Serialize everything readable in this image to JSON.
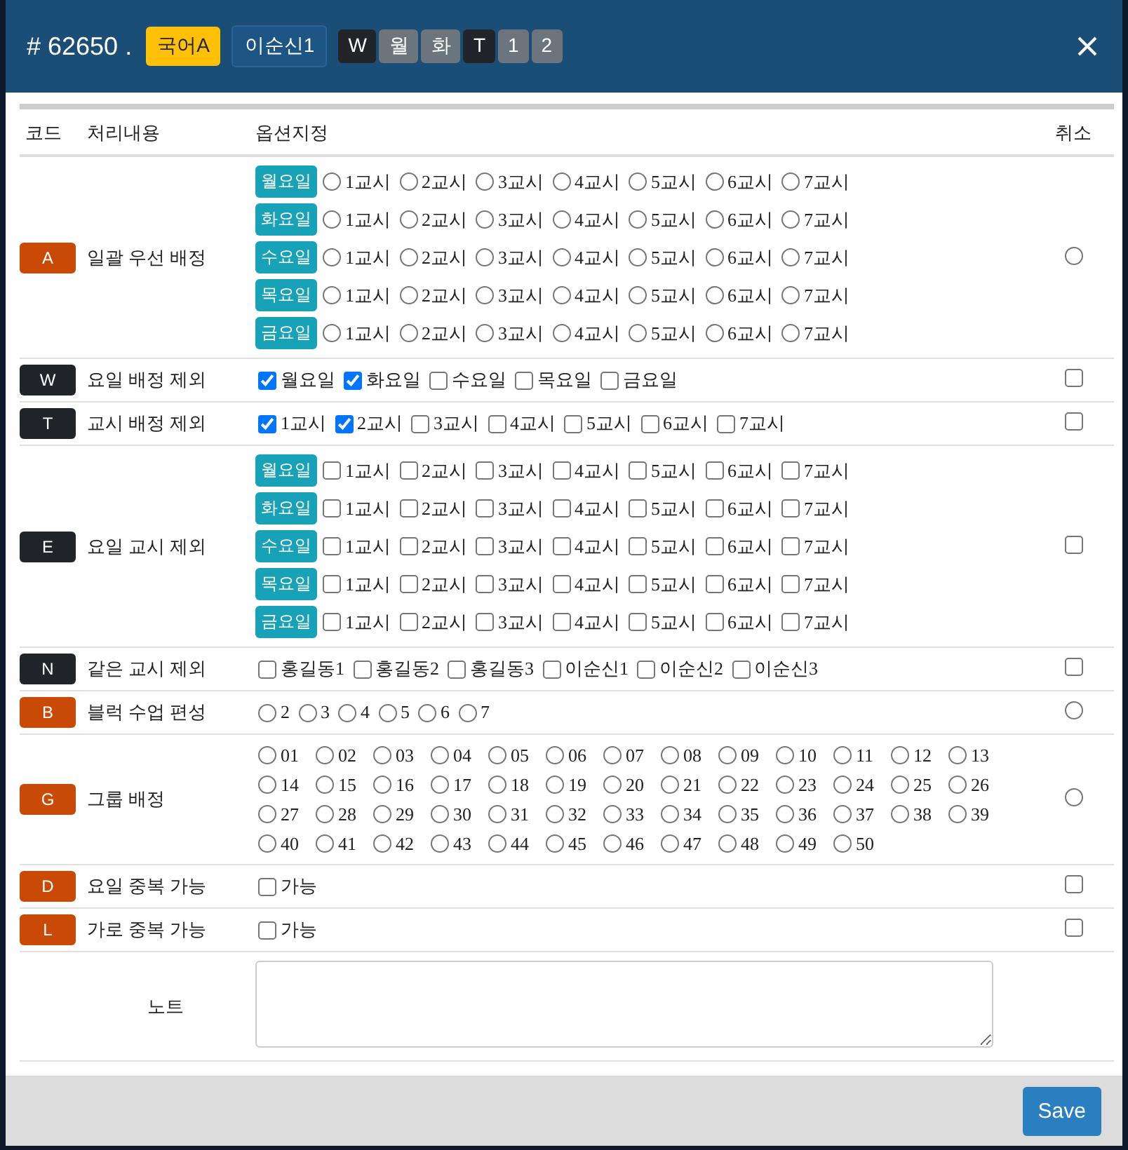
{
  "header": {
    "title": "# 62650 .",
    "subject": "국어A",
    "teacher": "이순신1",
    "tags": [
      {
        "label": "W",
        "color": "#212529"
      },
      {
        "label": "월",
        "color": "#6c757d"
      },
      {
        "label": "화",
        "color": "#6c757d"
      },
      {
        "label": "T",
        "color": "#212529"
      },
      {
        "label": "1",
        "color": "#6c757d"
      },
      {
        "label": "2",
        "color": "#6c757d"
      }
    ]
  },
  "columns": [
    "코드",
    "처리내용",
    "옵션지정",
    "취소"
  ],
  "rows": [
    {
      "code": "A",
      "color": "#c94a06",
      "label": "일괄 우선 배정",
      "kind": "radio_grid",
      "cancel": {
        "kind": "radio",
        "checked": false
      },
      "days": [
        {
          "label": "월요일",
          "periods": [
            {
              "label": "1교시",
              "checked": false
            },
            {
              "label": "2교시",
              "checked": false
            },
            {
              "label": "3교시",
              "checked": false
            },
            {
              "label": "4교시",
              "checked": false
            },
            {
              "label": "5교시",
              "checked": false
            },
            {
              "label": "6교시",
              "checked": false
            },
            {
              "label": "7교시",
              "checked": false
            }
          ]
        },
        {
          "label": "화요일",
          "periods": [
            {
              "label": "1교시",
              "checked": false
            },
            {
              "label": "2교시",
              "checked": false
            },
            {
              "label": "3교시",
              "checked": false
            },
            {
              "label": "4교시",
              "checked": false
            },
            {
              "label": "5교시",
              "checked": false
            },
            {
              "label": "6교시",
              "checked": false
            },
            {
              "label": "7교시",
              "checked": false
            }
          ]
        },
        {
          "label": "수요일",
          "periods": [
            {
              "label": "1교시",
              "checked": false
            },
            {
              "label": "2교시",
              "checked": false
            },
            {
              "label": "3교시",
              "checked": false
            },
            {
              "label": "4교시",
              "checked": false
            },
            {
              "label": "5교시",
              "checked": false
            },
            {
              "label": "6교시",
              "checked": false
            },
            {
              "label": "7교시",
              "checked": false
            }
          ]
        },
        {
          "label": "목요일",
          "periods": [
            {
              "label": "1교시",
              "checked": false
            },
            {
              "label": "2교시",
              "checked": false
            },
            {
              "label": "3교시",
              "checked": false
            },
            {
              "label": "4교시",
              "checked": false
            },
            {
              "label": "5교시",
              "checked": false
            },
            {
              "label": "6교시",
              "checked": false
            },
            {
              "label": "7교시",
              "checked": false
            }
          ]
        },
        {
          "label": "금요일",
          "periods": [
            {
              "label": "1교시",
              "checked": false
            },
            {
              "label": "2교시",
              "checked": false
            },
            {
              "label": "3교시",
              "checked": false
            },
            {
              "label": "4교시",
              "checked": false
            },
            {
              "label": "5교시",
              "checked": false
            },
            {
              "label": "6교시",
              "checked": false
            },
            {
              "label": "7교시",
              "checked": false
            }
          ]
        }
      ]
    },
    {
      "code": "W",
      "color": "#212529",
      "label": "요일 배정 제외",
      "kind": "checkbox_list",
      "cancel": {
        "kind": "checkbox",
        "checked": false
      },
      "options": [
        {
          "label": "월요일",
          "checked": true
        },
        {
          "label": "화요일",
          "checked": true
        },
        {
          "label": "수요일",
          "checked": false
        },
        {
          "label": "목요일",
          "checked": false
        },
        {
          "label": "금요일",
          "checked": false
        }
      ]
    },
    {
      "code": "T",
      "color": "#212529",
      "label": "교시 배정 제외",
      "kind": "checkbox_list",
      "cancel": {
        "kind": "checkbox",
        "checked": false
      },
      "options": [
        {
          "label": "1교시",
          "checked": true
        },
        {
          "label": "2교시",
          "checked": true
        },
        {
          "label": "3교시",
          "checked": false
        },
        {
          "label": "4교시",
          "checked": false
        },
        {
          "label": "5교시",
          "checked": false
        },
        {
          "label": "6교시",
          "checked": false
        },
        {
          "label": "7교시",
          "checked": false
        }
      ]
    },
    {
      "code": "E",
      "color": "#212529",
      "label": "요일 교시 제외",
      "kind": "checkbox_grid",
      "cancel": {
        "kind": "checkbox",
        "checked": false
      },
      "days": [
        {
          "label": "월요일",
          "periods": [
            {
              "label": "1교시",
              "checked": false
            },
            {
              "label": "2교시",
              "checked": false
            },
            {
              "label": "3교시",
              "checked": false
            },
            {
              "label": "4교시",
              "checked": false
            },
            {
              "label": "5교시",
              "checked": false
            },
            {
              "label": "6교시",
              "checked": false
            },
            {
              "label": "7교시",
              "checked": false
            }
          ]
        },
        {
          "label": "화요일",
          "periods": [
            {
              "label": "1교시",
              "checked": false
            },
            {
              "label": "2교시",
              "checked": false
            },
            {
              "label": "3교시",
              "checked": false
            },
            {
              "label": "4교시",
              "checked": false
            },
            {
              "label": "5교시",
              "checked": false
            },
            {
              "label": "6교시",
              "checked": false
            },
            {
              "label": "7교시",
              "checked": false
            }
          ]
        },
        {
          "label": "수요일",
          "periods": [
            {
              "label": "1교시",
              "checked": false
            },
            {
              "label": "2교시",
              "checked": false
            },
            {
              "label": "3교시",
              "checked": false
            },
            {
              "label": "4교시",
              "checked": false
            },
            {
              "label": "5교시",
              "checked": false
            },
            {
              "label": "6교시",
              "checked": false
            },
            {
              "label": "7교시",
              "checked": false
            }
          ]
        },
        {
          "label": "목요일",
          "periods": [
            {
              "label": "1교시",
              "checked": false
            },
            {
              "label": "2교시",
              "checked": false
            },
            {
              "label": "3교시",
              "checked": false
            },
            {
              "label": "4교시",
              "checked": false
            },
            {
              "label": "5교시",
              "checked": false
            },
            {
              "label": "6교시",
              "checked": false
            },
            {
              "label": "7교시",
              "checked": false
            }
          ]
        },
        {
          "label": "금요일",
          "periods": [
            {
              "label": "1교시",
              "checked": false
            },
            {
              "label": "2교시",
              "checked": false
            },
            {
              "label": "3교시",
              "checked": false
            },
            {
              "label": "4교시",
              "checked": false
            },
            {
              "label": "5교시",
              "checked": false
            },
            {
              "label": "6교시",
              "checked": false
            },
            {
              "label": "7교시",
              "checked": false
            }
          ]
        }
      ]
    },
    {
      "code": "N",
      "color": "#212529",
      "label": "같은 교시 제외",
      "kind": "checkbox_list",
      "cancel": {
        "kind": "checkbox",
        "checked": false
      },
      "options": [
        {
          "label": "홍길동1",
          "checked": false
        },
        {
          "label": "홍길동2",
          "checked": false
        },
        {
          "label": "홍길동3",
          "checked": false
        },
        {
          "label": "이순신1",
          "checked": false
        },
        {
          "label": "이순신2",
          "checked": false
        },
        {
          "label": "이순신3",
          "checked": false
        }
      ]
    },
    {
      "code": "B",
      "color": "#c94a06",
      "label": "블럭 수업 편성",
      "kind": "radio_list",
      "cancel": {
        "kind": "radio",
        "checked": false
      },
      "options": [
        {
          "label": "2",
          "checked": false
        },
        {
          "label": "3",
          "checked": false
        },
        {
          "label": "4",
          "checked": false
        },
        {
          "label": "5",
          "checked": false
        },
        {
          "label": "6",
          "checked": false
        },
        {
          "label": "7",
          "checked": false
        }
      ]
    },
    {
      "code": "G",
      "color": "#c94a06",
      "label": "그룹 배정",
      "kind": "radio_list",
      "cancel": {
        "kind": "radio",
        "checked": false
      },
      "options": [
        {
          "label": "01",
          "checked": false
        },
        {
          "label": "02",
          "checked": false
        },
        {
          "label": "03",
          "checked": false
        },
        {
          "label": "04",
          "checked": false
        },
        {
          "label": "05",
          "checked": false
        },
        {
          "label": "06",
          "checked": false
        },
        {
          "label": "07",
          "checked": false
        },
        {
          "label": "08",
          "checked": false
        },
        {
          "label": "09",
          "checked": false
        },
        {
          "label": "10",
          "checked": false
        },
        {
          "label": "11",
          "checked": false
        },
        {
          "label": "12",
          "checked": false
        },
        {
          "label": "13",
          "checked": false
        },
        {
          "label": "14",
          "checked": false
        },
        {
          "label": "15",
          "checked": false
        },
        {
          "label": "16",
          "checked": false
        },
        {
          "label": "17",
          "checked": false
        },
        {
          "label": "18",
          "checked": false
        },
        {
          "label": "19",
          "checked": false
        },
        {
          "label": "20",
          "checked": false
        },
        {
          "label": "21",
          "checked": false
        },
        {
          "label": "22",
          "checked": false
        },
        {
          "label": "23",
          "checked": false
        },
        {
          "label": "24",
          "checked": false
        },
        {
          "label": "25",
          "checked": false
        },
        {
          "label": "26",
          "checked": false
        },
        {
          "label": "27",
          "checked": false
        },
        {
          "label": "28",
          "checked": false
        },
        {
          "label": "29",
          "checked": false
        },
        {
          "label": "30",
          "checked": false
        },
        {
          "label": "31",
          "checked": false
        },
        {
          "label": "32",
          "checked": false
        },
        {
          "label": "33",
          "checked": false
        },
        {
          "label": "34",
          "checked": false
        },
        {
          "label": "35",
          "checked": false
        },
        {
          "label": "36",
          "checked": false
        },
        {
          "label": "37",
          "checked": false
        },
        {
          "label": "38",
          "checked": false
        },
        {
          "label": "39",
          "checked": false
        },
        {
          "label": "40",
          "checked": false
        },
        {
          "label": "41",
          "checked": false
        },
        {
          "label": "42",
          "checked": false
        },
        {
          "label": "43",
          "checked": false
        },
        {
          "label": "44",
          "checked": false
        },
        {
          "label": "45",
          "checked": false
        },
        {
          "label": "46",
          "checked": false
        },
        {
          "label": "47",
          "checked": false
        },
        {
          "label": "48",
          "checked": false
        },
        {
          "label": "49",
          "checked": false
        },
        {
          "label": "50",
          "checked": false
        }
      ]
    },
    {
      "code": "D",
      "color": "#c94a06",
      "label": "요일 중복 가능",
      "kind": "checkbox_list",
      "cancel": {
        "kind": "checkbox",
        "checked": false
      },
      "options": [
        {
          "label": "가능",
          "checked": false
        }
      ]
    },
    {
      "code": "L",
      "color": "#c94a06",
      "label": "가로 중복 가능",
      "kind": "checkbox_list",
      "cancel": {
        "kind": "checkbox",
        "checked": false
      },
      "options": [
        {
          "label": "가능",
          "checked": false
        }
      ]
    },
    {
      "label": "노트",
      "kind": "note"
    }
  ],
  "save_button": "Save"
}
